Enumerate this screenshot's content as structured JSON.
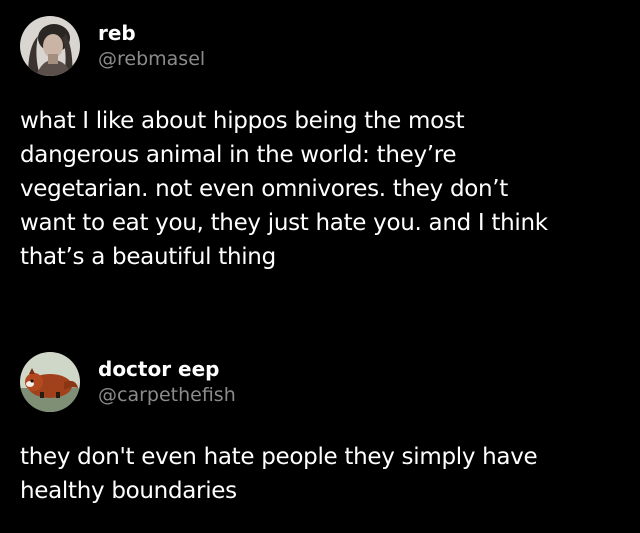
{
  "posts": [
    {
      "display_name": "reb",
      "handle": "@rebmasel",
      "avatar_icon": "person-photo-avatar",
      "text_lines": [
        "what I like about hippos being the most",
        "dangerous animal in the world: they’re",
        "vegetarian. not even omnivores. they don’t",
        "want to eat you, they just hate you. and I think",
        "that’s a beautiful thing"
      ]
    },
    {
      "display_name": "doctor eep",
      "handle": "@carpethefish",
      "avatar_icon": "red-panda-avatar",
      "text_lines": [
        "they don't even hate people they simply have",
        "healthy boundaries"
      ]
    }
  ],
  "colors": {
    "background": "#000000",
    "text": "#ffffff",
    "handle": "#8b8b8b"
  }
}
